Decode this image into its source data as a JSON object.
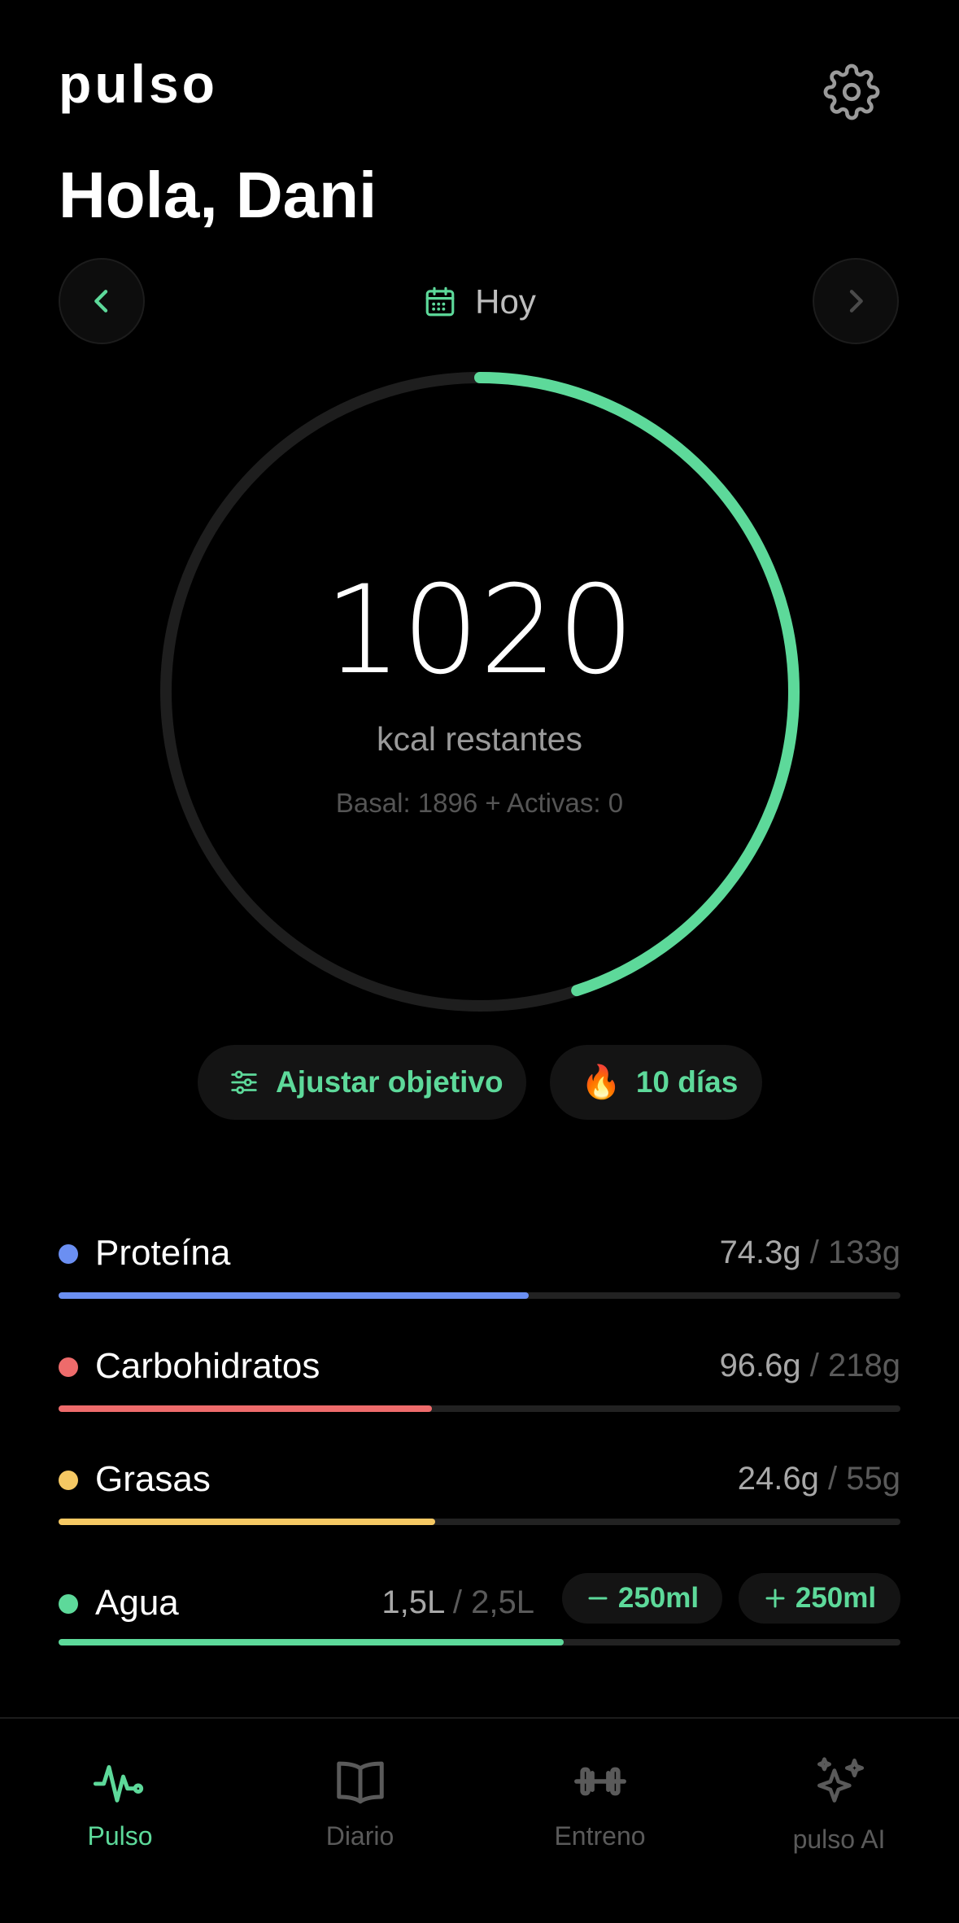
{
  "app": {
    "logo": "pulso"
  },
  "header": {
    "greeting": "Hola, Dani",
    "settings_icon": "gear-icon"
  },
  "date_nav": {
    "label": "Hoy",
    "prev_icon": "chevron-left-icon",
    "next_icon": "chevron-right-icon",
    "calendar_icon": "calendar-icon"
  },
  "calories": {
    "remaining": "1020",
    "unit_label": "kcal restantes",
    "breakdown": "Basal: 1896 + Activas: 0",
    "ring_progress": 0.45
  },
  "actions": {
    "adjust_label": "Ajustar objetivo",
    "streak_label": "10 días",
    "streak_icon": "🔥"
  },
  "macros": [
    {
      "name": "Proteína",
      "value": "74.3g",
      "sep": " / ",
      "goal": "133g",
      "color": "#6b8ff2",
      "progress": 0.558
    },
    {
      "name": "Carbohidratos",
      "value": "96.6g",
      "sep": " / ",
      "goal": "218g",
      "color": "#ee6b6b",
      "progress": 0.443
    },
    {
      "name": "Grasas",
      "value": "24.6g",
      "sep": " / ",
      "goal": "55g",
      "color": "#f5c863",
      "progress": 0.447
    }
  ],
  "water": {
    "name": "Agua",
    "value": "1,5L",
    "sep": " / ",
    "goal": "2,5L",
    "color": "#5dd99a",
    "progress": 0.6,
    "minus_label": "250ml",
    "plus_label": "250ml"
  },
  "tabs": [
    {
      "label": "Pulso",
      "icon": "heartbeat-icon",
      "active": true
    },
    {
      "label": "Diario",
      "icon": "book-icon",
      "active": false
    },
    {
      "label": "Entreno",
      "icon": "dumbbell-icon",
      "active": false
    },
    {
      "label": "pulso AI",
      "icon": "sparkles-icon",
      "active": false
    }
  ],
  "colors": {
    "accent": "#5dd99a",
    "background": "#000000",
    "ring_track": "#1e1e1e"
  }
}
